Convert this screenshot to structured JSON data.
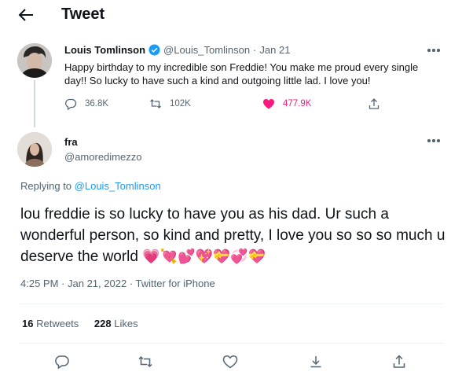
{
  "header": {
    "title": "Tweet",
    "back_icon": "arrow-left-icon"
  },
  "parent_tweet": {
    "name": "Louis Tomlinson",
    "verified": true,
    "handle": "@Louis_Tomlinson",
    "separator": "·",
    "date": "Jan 21",
    "text": "Happy birthday to my incredible son Freddie! You make me proud every single day!! So lucky to have such a kind and outgoing little lad. I love you!",
    "replies": "36.8K",
    "retweets": "102K",
    "likes": "477.9K",
    "liked": true
  },
  "reply_tweet": {
    "name": "fra",
    "handle": "@amoredimezzo",
    "replying_prefix": "Replying to",
    "replying_to": "@Louis_Tomlinson",
    "text": "lou freddie is so lucky to have you as his dad. Ur such a wonderful person, so kind and pretty, I love you so so so much u deserve the world",
    "emojis": "💗💘💕💖💝💞💝",
    "time": "4:25 PM",
    "date": "Jan 21, 2022",
    "source": "Twitter for iPhone",
    "retweets_count": "16",
    "retweets_label": "Retweets",
    "likes_count": "228",
    "likes_label": "Likes"
  },
  "colors": {
    "accent": "#1d9bf0",
    "like": "#f91880",
    "muted": "#536471",
    "text": "#0f1419"
  }
}
